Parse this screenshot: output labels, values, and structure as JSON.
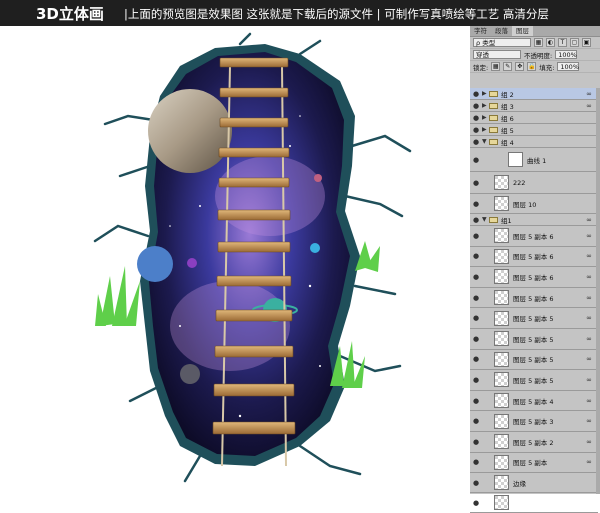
{
  "banner": {
    "title": "3D立体画",
    "description": "|上面的预览图是效果图  这张就是下载后的源文件 | 可制作写真喷绘等工艺  高清分层"
  },
  "panel": {
    "tabs": [
      "字符",
      "段落",
      "图层"
    ],
    "active_tab": "图层",
    "kind_filter": "ρ 类型",
    "blend_mode": "穿透",
    "opacity_label": "不透明度:",
    "opacity_value": "100%",
    "lock_label": "锁定:",
    "fill_label": "填充:",
    "fill_value": "100%"
  },
  "layers": [
    {
      "name": "组 2",
      "type": "group",
      "expanded": false,
      "selected": true,
      "link": true
    },
    {
      "name": "组 3",
      "type": "group",
      "expanded": false,
      "link": true
    },
    {
      "name": "组 6",
      "type": "group",
      "expanded": false
    },
    {
      "name": "组 5",
      "type": "group",
      "expanded": false
    },
    {
      "name": "组 4",
      "type": "group",
      "expanded": true
    },
    {
      "name": "曲线 1",
      "type": "adjustment"
    },
    {
      "name": "222",
      "type": "text"
    },
    {
      "name": "图层 10",
      "type": "layer"
    },
    {
      "name": "组1",
      "type": "group",
      "expanded": true,
      "link": true
    },
    {
      "name": "图层 5 副本 6",
      "type": "layer",
      "link": true
    },
    {
      "name": "图层 5 副本 6",
      "type": "layer",
      "link": true
    },
    {
      "name": "图层 5 副本 6",
      "type": "layer",
      "link": true
    },
    {
      "name": "图层 5 副本 6",
      "type": "layer",
      "link": true
    },
    {
      "name": "图层 5 副本 5",
      "type": "layer",
      "link": true
    },
    {
      "name": "图层 5 副本 5",
      "type": "layer",
      "link": true
    },
    {
      "name": "图层 5 副本 5",
      "type": "layer",
      "link": true
    },
    {
      "name": "图层 5 副本 5",
      "type": "layer",
      "link": true
    },
    {
      "name": "图层 5 副本 4",
      "type": "layer",
      "link": true
    },
    {
      "name": "图层 5 副本 3",
      "type": "layer",
      "link": true
    },
    {
      "name": "图层 5 副本 2",
      "type": "layer",
      "link": true
    },
    {
      "name": "图层 5 副本",
      "type": "layer",
      "link": true
    },
    {
      "name": "边缘",
      "type": "layer"
    },
    {
      "name": "",
      "type": "layer"
    }
  ],
  "colors": {
    "banner_bg": "#1f1f1f",
    "panel_bg": "#c4c4c4",
    "selected_row": "#b9c8e4",
    "wall_crack": "#1f4f5a",
    "space": "#2a1f5c"
  }
}
